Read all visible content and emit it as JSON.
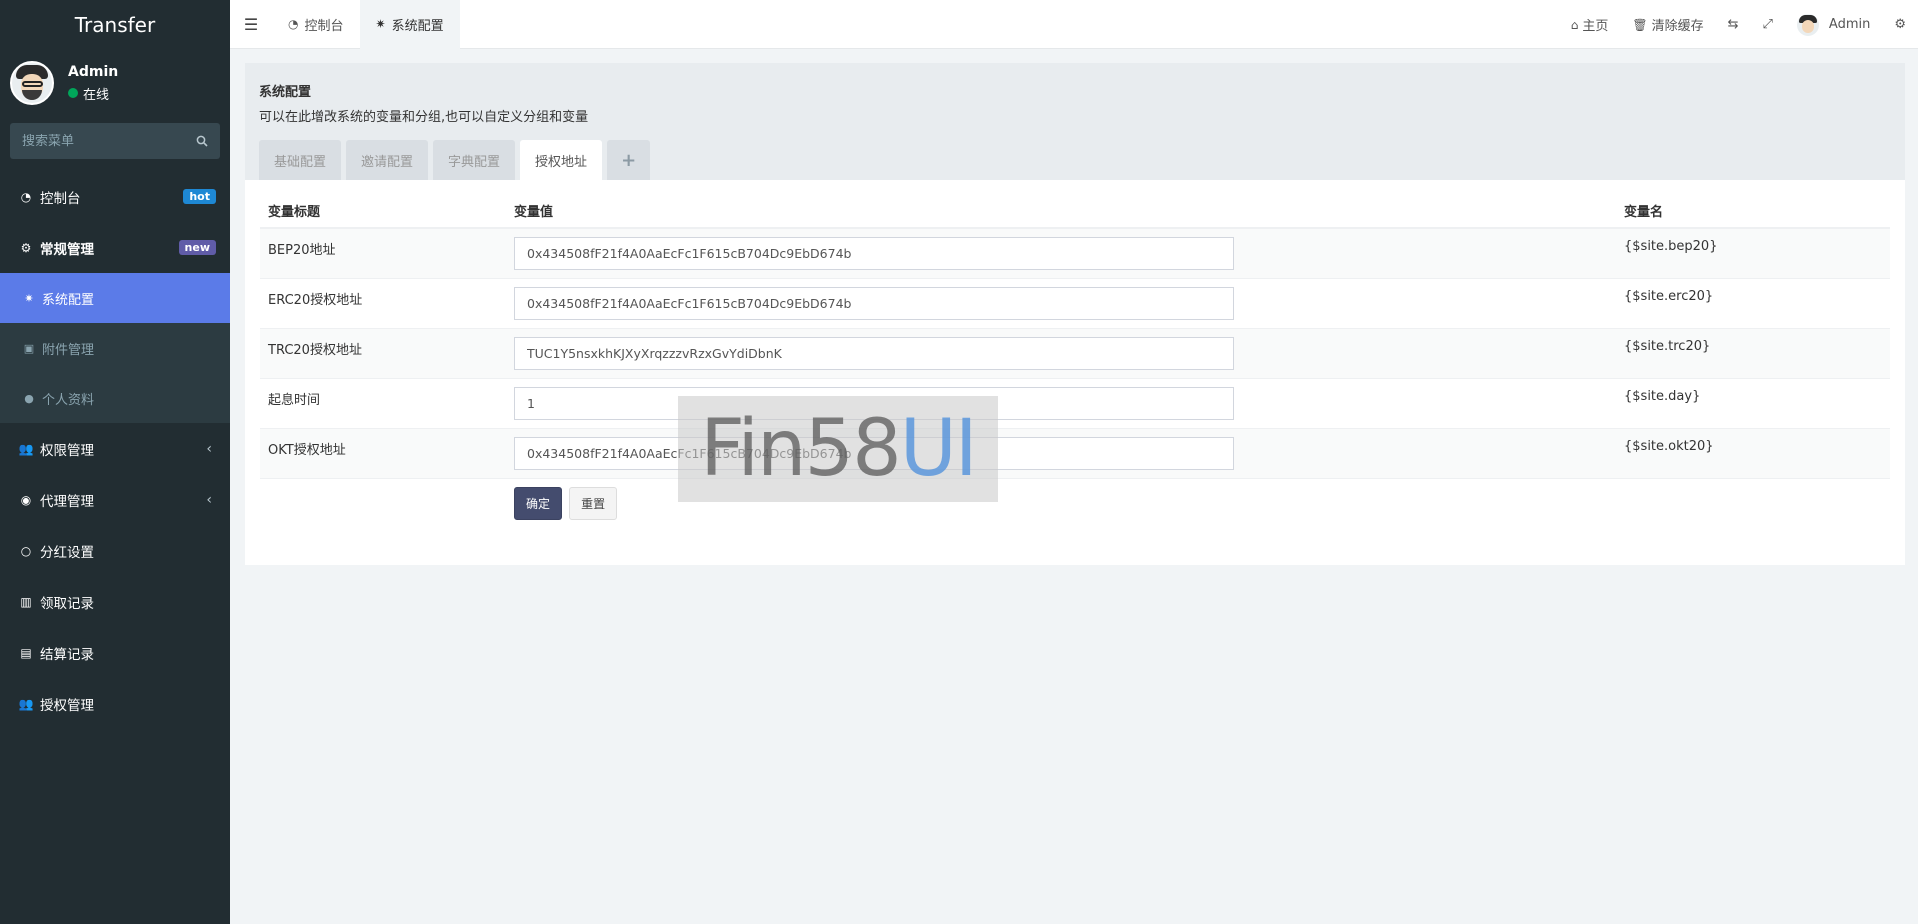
{
  "app": {
    "title": "Transfer"
  },
  "user": {
    "name": "Admin",
    "status": "在线"
  },
  "search": {
    "placeholder": "搜索菜单"
  },
  "menu": {
    "dashboard": {
      "label": "控制台",
      "badge": "hot"
    },
    "general": {
      "label": "常规管理",
      "badge": "new"
    },
    "general_items": [
      "系统配置",
      "附件管理",
      "个人资料"
    ],
    "permission": "权限管理",
    "agent": "代理管理",
    "dividend": "分红设置",
    "claim": "领取记录",
    "settlement": "结算记录",
    "auth": "授权管理"
  },
  "topbar": {
    "tabs": [
      "控制台",
      "系统配置"
    ],
    "home": "主页",
    "clear_cache": "清除缓存",
    "admin": "Admin"
  },
  "panel": {
    "title": "系统配置",
    "desc": "可以在此增改系统的变量和分组,也可以自定义分组和变量",
    "tabs": [
      "基础配置",
      "邀请配置",
      "字典配置",
      "授权地址"
    ],
    "plus": "+"
  },
  "table": {
    "headers": [
      "变量标题",
      "变量值",
      "变量名"
    ],
    "rows": [
      {
        "title": "BEP20地址",
        "value": "0x434508fF21f4A0AaEcFc1F615cB704Dc9EbD674b",
        "name": "{$site.bep20}"
      },
      {
        "title": "ERC20授权地址",
        "value": "0x434508fF21f4A0AaEcFc1F615cB704Dc9EbD674b",
        "name": "{$site.erc20}"
      },
      {
        "title": "TRC20授权地址",
        "value": "TUC1Y5nsxkhKJXyXrqzzzvRzxGvYdiDbnK",
        "name": "{$site.trc20}"
      },
      {
        "title": "起息时间",
        "value": "1",
        "name": "{$site.day}"
      },
      {
        "title": "OKT授权地址",
        "value": "0x434508fF21f4A0AaEcFc1F615cB704Dc9EbD674b",
        "name": "{$site.okt20}"
      }
    ]
  },
  "buttons": {
    "submit": "确定",
    "reset": "重置"
  },
  "watermark": {
    "part1": "Fin58",
    "part2": "UI"
  },
  "colors": {
    "sidebar": "#222d32",
    "active": "#5b7be8",
    "primary_button": "#444c6e"
  }
}
